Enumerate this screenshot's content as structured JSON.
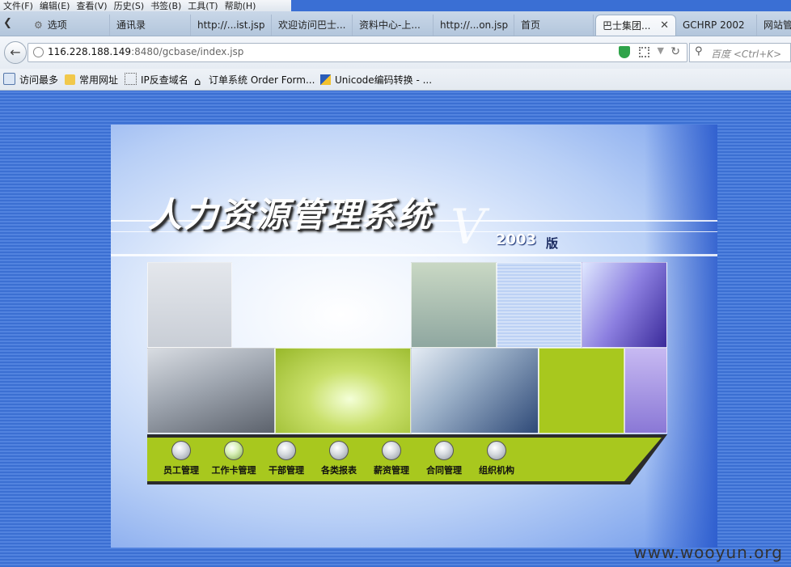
{
  "menu": [
    "文件(F)",
    "编辑(E)",
    "查看(V)",
    "历史(S)",
    "书签(B)",
    "工具(T)",
    "帮助(H)"
  ],
  "tabs": [
    {
      "label": "选项"
    },
    {
      "label": "通讯录"
    },
    {
      "label": "http://...ist.jsp"
    },
    {
      "label": "欢迎访问巴士..."
    },
    {
      "label": "资料中心-上..."
    },
    {
      "label": "http://...on.jsp"
    },
    {
      "label": "首页"
    },
    {
      "label": "巴士集团...",
      "active": true
    },
    {
      "label": "GCHRP 2002"
    },
    {
      "label": "网站管"
    }
  ],
  "address": {
    "host": "116.228.188.149",
    "rest": ":8480/gcbase/index.jsp"
  },
  "search": {
    "placeholder": "百度 <Ctrl+K>"
  },
  "bookmarks": [
    {
      "label": "访问最多",
      "icon": "search-page-icon"
    },
    {
      "label": "常用网址",
      "icon": "folder-icon"
    },
    {
      "label": "IP反查域名",
      "icon": "dotted-page-icon"
    },
    {
      "label": "订单系统 Order Form...",
      "icon": "home-icon"
    },
    {
      "label": "Unicode编码转换 - ...",
      "icon": "app-icon"
    }
  ],
  "app": {
    "title": "人力资源管理系统",
    "version_mark": "V",
    "version": "2003",
    "version_label": "版",
    "nav": [
      {
        "label": "员工管理"
      },
      {
        "label": "工作卡管理",
        "highlighted": true
      },
      {
        "label": "干部管理"
      },
      {
        "label": "各类报表"
      },
      {
        "label": "薪资管理"
      },
      {
        "label": "合同管理"
      },
      {
        "label": "组织机构"
      }
    ]
  },
  "watermark": "www.wooyun.org",
  "colors": {
    "accent_green": "#a8c81e",
    "background_blue": "#3b6fd2"
  }
}
